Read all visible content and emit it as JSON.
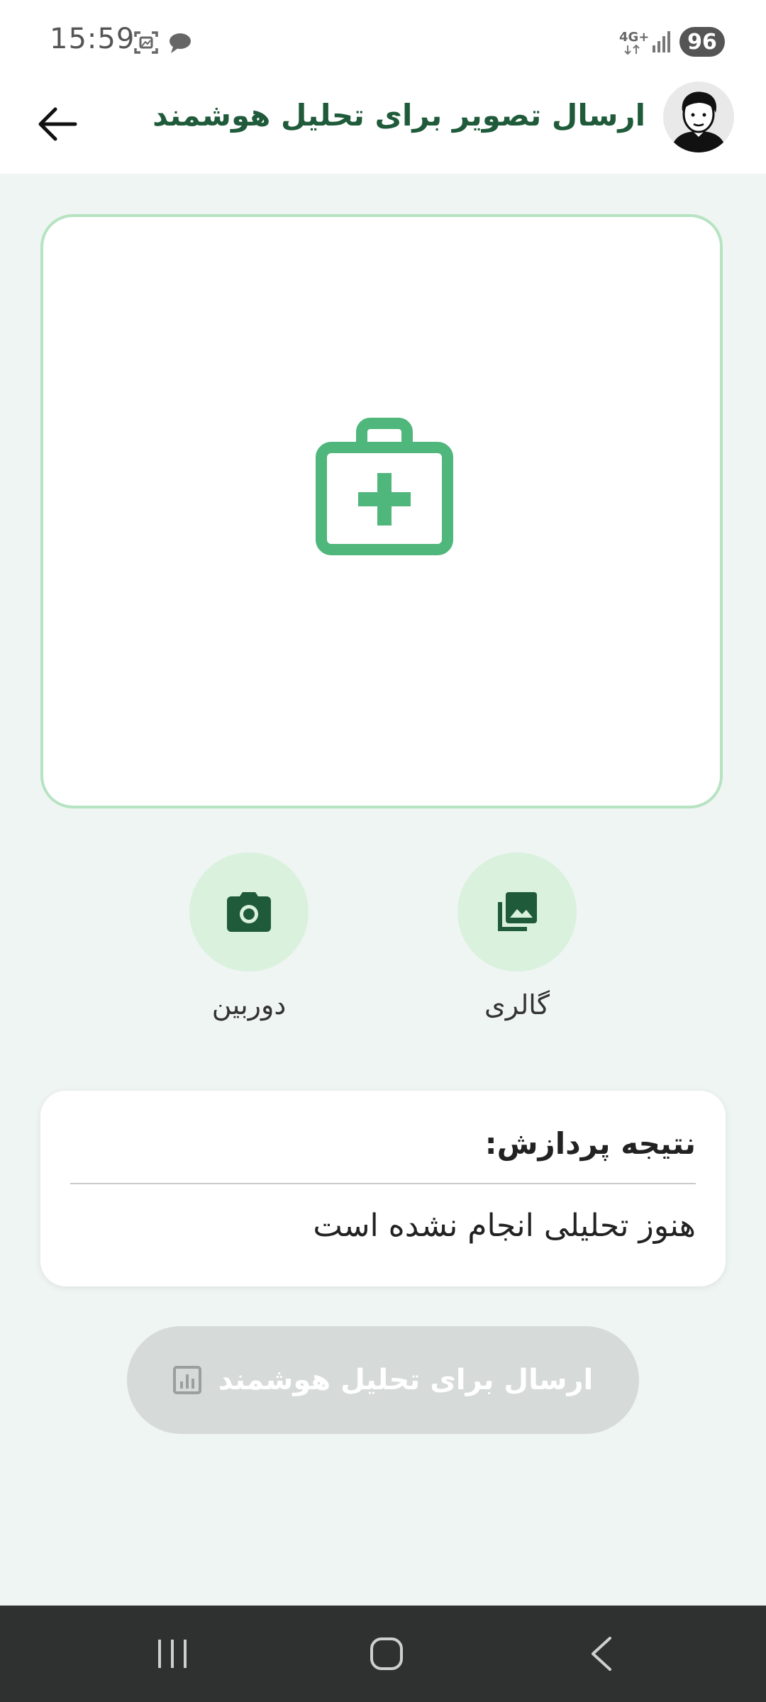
{
  "status_bar": {
    "time": "15:59",
    "network_label": "4G+",
    "battery": "96",
    "icons": [
      "screenshot-icon",
      "chat-bubble-icon",
      "signal-icon"
    ]
  },
  "app_bar": {
    "title": "ارسال تصویر برای تحلیل هوشمند",
    "back_icon": "arrow-left-icon",
    "avatar": "user-avatar"
  },
  "image_picker": {
    "placeholder_icon": "medical-kit-icon",
    "border_color": "#b6e3c1",
    "icon_color": "#4fb67c"
  },
  "actions": {
    "camera_label": "دوربین",
    "gallery_label": "گالری",
    "button_bg": "#d9f1dd",
    "icon_color": "#1f5b3a"
  },
  "result": {
    "title": "نتیجه پردازش:",
    "text": "هنوز تحلیلی انجام نشده است"
  },
  "submit": {
    "label": "ارسال برای تحلیل هوشمند",
    "icon": "analytics-icon",
    "disabled": true
  },
  "nav_bar": {
    "buttons": [
      "recents-icon",
      "home-icon",
      "back-nav-icon"
    ]
  }
}
